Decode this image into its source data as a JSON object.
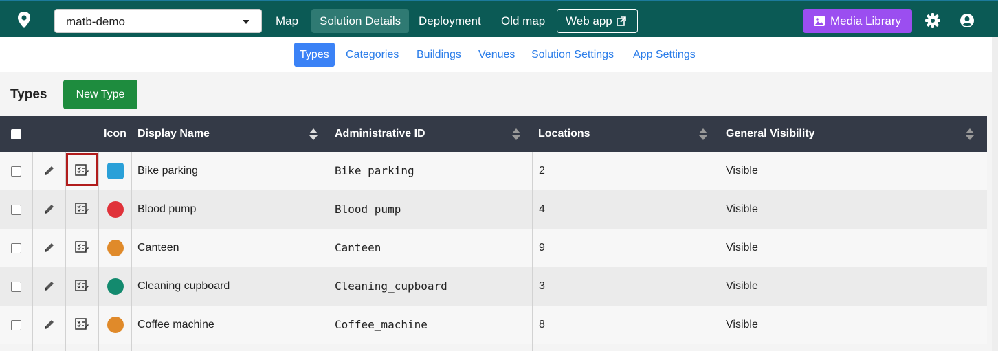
{
  "nav": {
    "project": "matb-demo",
    "links": [
      "Map",
      "Solution Details",
      "Deployment",
      "Old map"
    ],
    "webapp_label": "Web app",
    "media_label": "Media Library"
  },
  "subnav": [
    "Types",
    "Categories",
    "Buildings",
    "Venues",
    "Solution Settings",
    "App Settings"
  ],
  "page": {
    "title": "Types",
    "new_button": "New Type"
  },
  "table": {
    "columns": [
      "Icon",
      "Display Name",
      "Administrative ID",
      "Locations",
      "General Visibility"
    ],
    "rows": [
      {
        "name": "Bike parking",
        "admin_id": "Bike_parking",
        "locations": "2",
        "visibility": "Visible",
        "icon": "bike-icon",
        "color": "#2aa0d8"
      },
      {
        "name": "Blood pump",
        "admin_id": "Blood pump",
        "locations": "4",
        "visibility": "Visible",
        "icon": "heart-icon",
        "color": "#e0323a"
      },
      {
        "name": "Canteen",
        "admin_id": "Canteen",
        "locations": "9",
        "visibility": "Visible",
        "icon": "cutlery-icon",
        "color": "#e08a2a"
      },
      {
        "name": "Cleaning cupboard",
        "admin_id": "Cleaning_cupboard",
        "locations": "3",
        "visibility": "Visible",
        "icon": "broom-icon",
        "color": "#138a6e"
      },
      {
        "name": "Coffee machine",
        "admin_id": "Coffee_machine",
        "locations": "8",
        "visibility": "Visible",
        "icon": "coffee-icon",
        "color": "#e08a2a"
      }
    ]
  },
  "colors": {
    "topbar": "#0b5a55",
    "accent": "#3b82f6",
    "new_button": "#1e8c3e",
    "media_button": "#9b4ef0"
  }
}
